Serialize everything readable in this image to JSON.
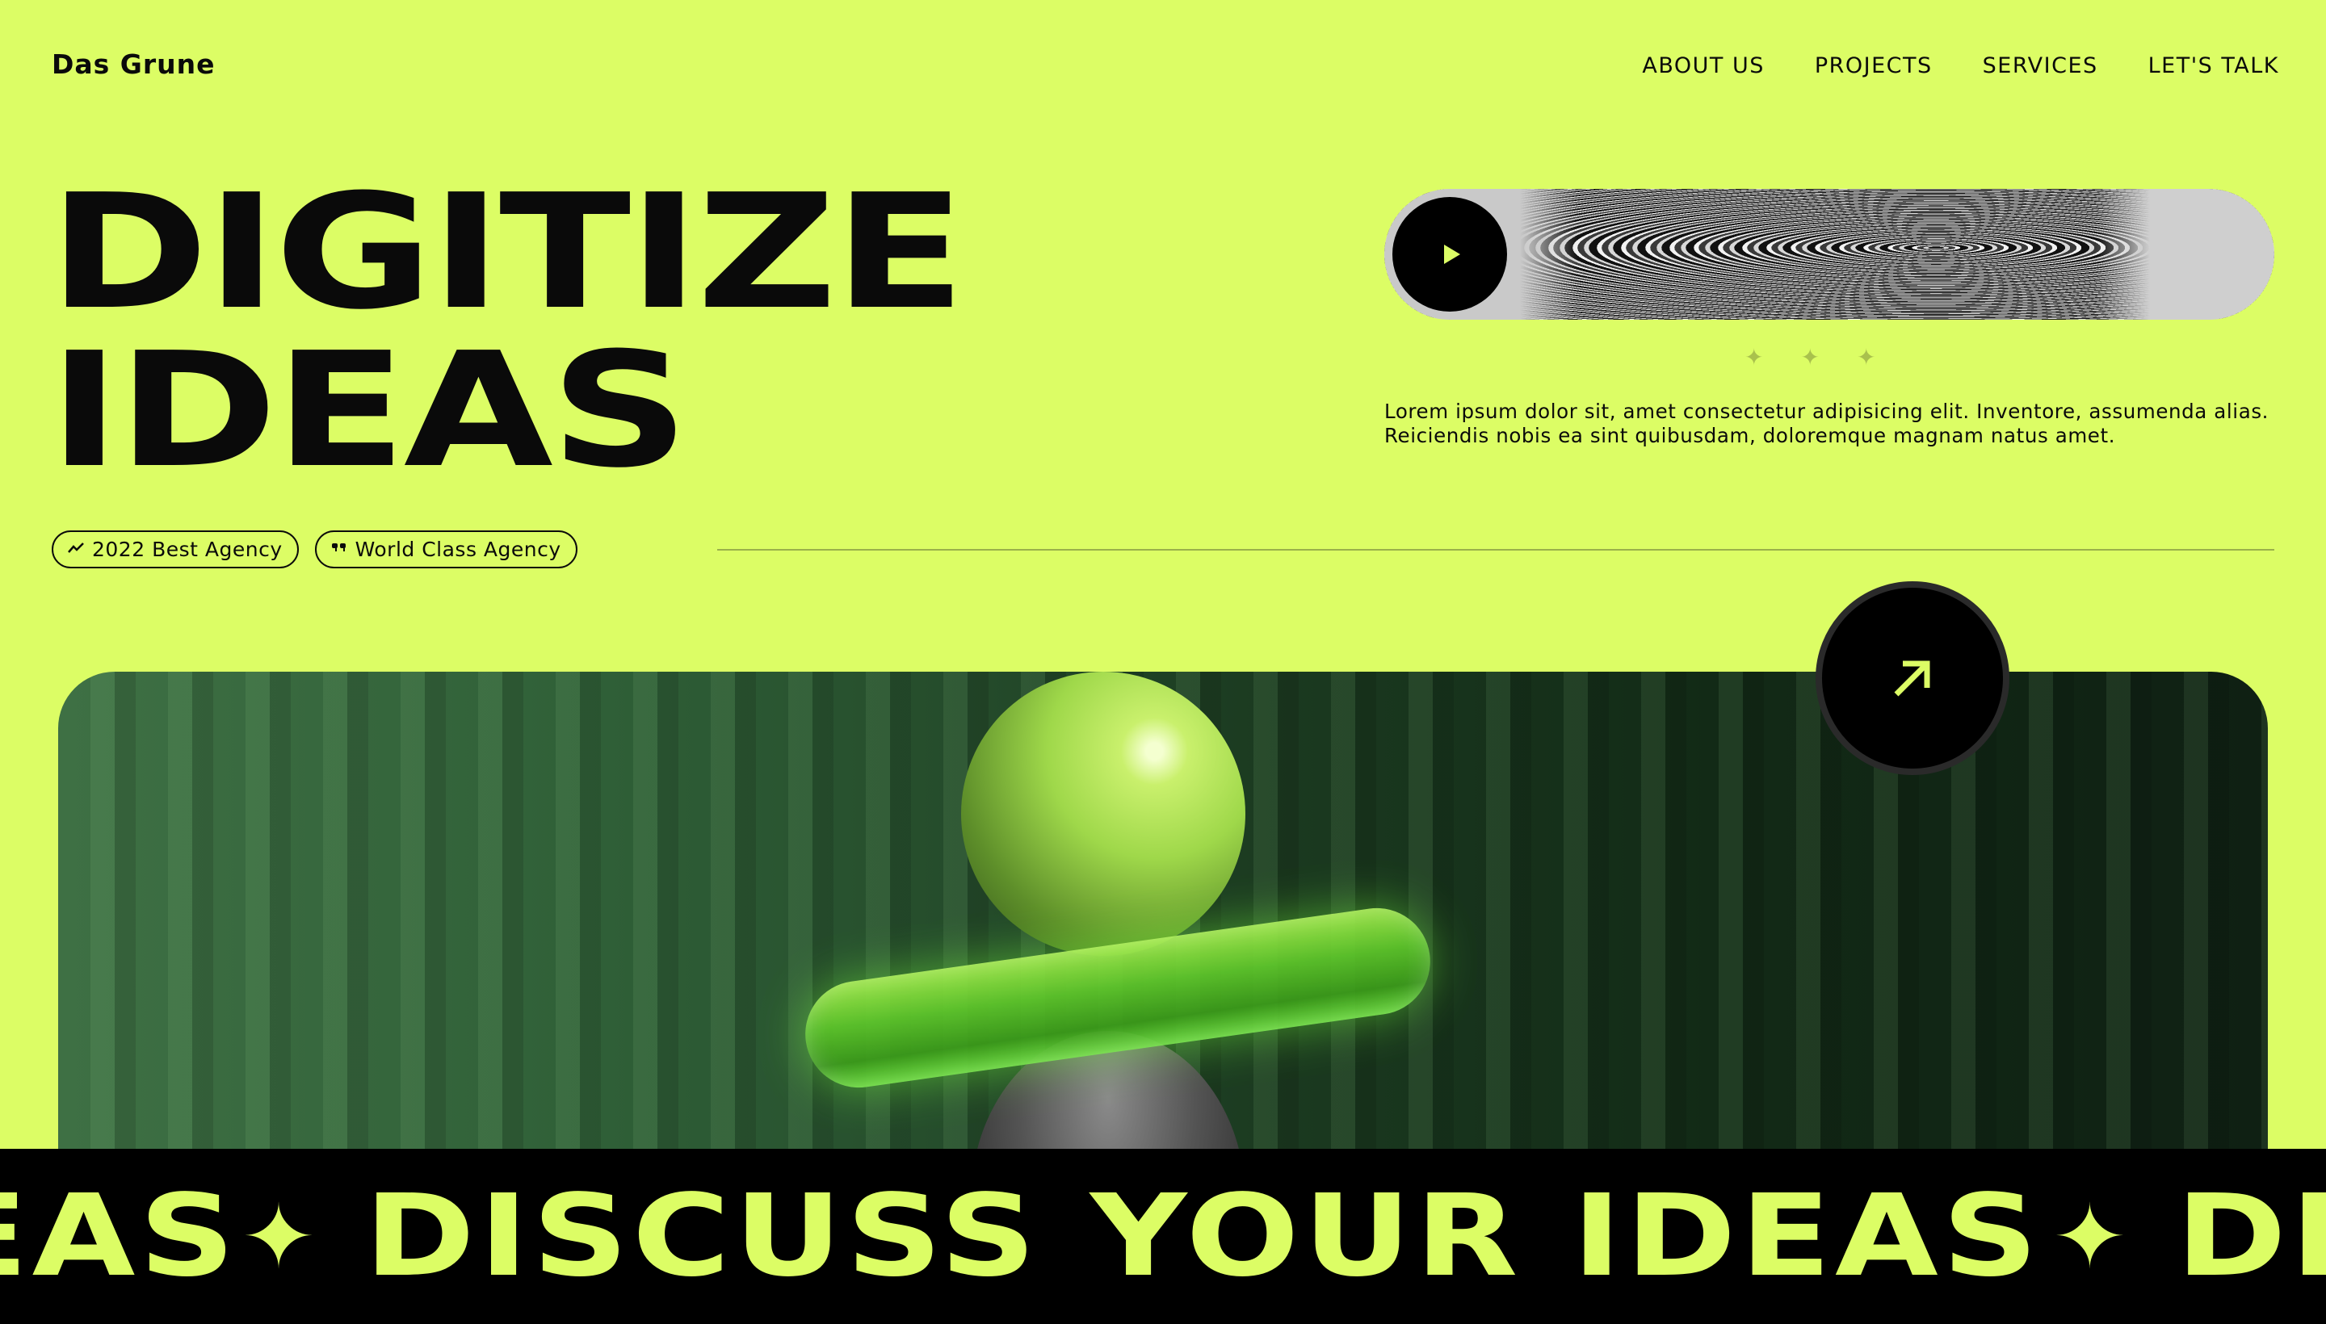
{
  "header": {
    "brand": "Das Grune",
    "nav": [
      "ABOUT US",
      "PROJECTS",
      "SERVICES",
      "LET'S TALK"
    ]
  },
  "hero": {
    "title_line1": "DIGITIZE",
    "title_line2": "IDEAS",
    "description": "Lorem ipsum dolor sit, amet consectetur adipisicing elit. Inventore, assumenda alias. Reiciendis nobis ea sint quibusdam, doloremque magnam natus amet.",
    "badges": [
      {
        "icon": "trend-icon",
        "label": "2022 Best Agency"
      },
      {
        "icon": "quote-icon",
        "label": "World Class Agency"
      }
    ]
  },
  "marquee": {
    "parts": [
      "EAS",
      "DISCUSS YOUR IDEAS",
      "DISC"
    ]
  },
  "colors": {
    "accent": "#dcfd65",
    "dark": "#000000"
  }
}
